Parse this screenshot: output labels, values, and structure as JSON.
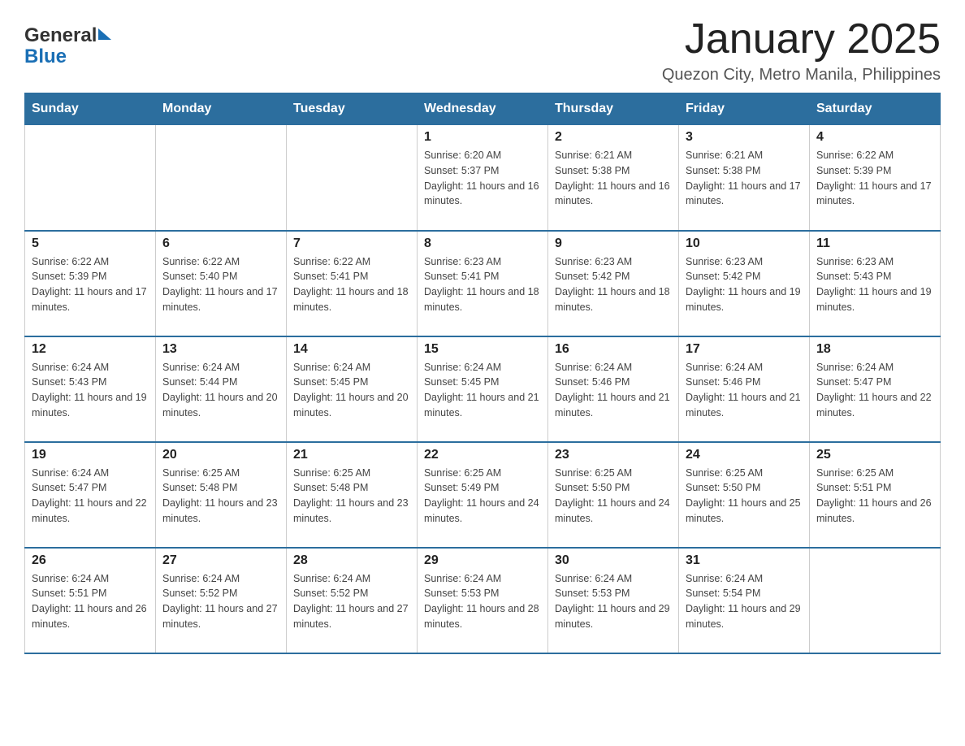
{
  "header": {
    "logo_general": "General",
    "logo_blue": "Blue",
    "main_title": "January 2025",
    "subtitle": "Quezon City, Metro Manila, Philippines"
  },
  "calendar": {
    "days_of_week": [
      "Sunday",
      "Monday",
      "Tuesday",
      "Wednesday",
      "Thursday",
      "Friday",
      "Saturday"
    ],
    "rows": [
      [
        {
          "day": "",
          "info": ""
        },
        {
          "day": "",
          "info": ""
        },
        {
          "day": "",
          "info": ""
        },
        {
          "day": "1",
          "info": "Sunrise: 6:20 AM\nSunset: 5:37 PM\nDaylight: 11 hours and 16 minutes."
        },
        {
          "day": "2",
          "info": "Sunrise: 6:21 AM\nSunset: 5:38 PM\nDaylight: 11 hours and 16 minutes."
        },
        {
          "day": "3",
          "info": "Sunrise: 6:21 AM\nSunset: 5:38 PM\nDaylight: 11 hours and 17 minutes."
        },
        {
          "day": "4",
          "info": "Sunrise: 6:22 AM\nSunset: 5:39 PM\nDaylight: 11 hours and 17 minutes."
        }
      ],
      [
        {
          "day": "5",
          "info": "Sunrise: 6:22 AM\nSunset: 5:39 PM\nDaylight: 11 hours and 17 minutes."
        },
        {
          "day": "6",
          "info": "Sunrise: 6:22 AM\nSunset: 5:40 PM\nDaylight: 11 hours and 17 minutes."
        },
        {
          "day": "7",
          "info": "Sunrise: 6:22 AM\nSunset: 5:41 PM\nDaylight: 11 hours and 18 minutes."
        },
        {
          "day": "8",
          "info": "Sunrise: 6:23 AM\nSunset: 5:41 PM\nDaylight: 11 hours and 18 minutes."
        },
        {
          "day": "9",
          "info": "Sunrise: 6:23 AM\nSunset: 5:42 PM\nDaylight: 11 hours and 18 minutes."
        },
        {
          "day": "10",
          "info": "Sunrise: 6:23 AM\nSunset: 5:42 PM\nDaylight: 11 hours and 19 minutes."
        },
        {
          "day": "11",
          "info": "Sunrise: 6:23 AM\nSunset: 5:43 PM\nDaylight: 11 hours and 19 minutes."
        }
      ],
      [
        {
          "day": "12",
          "info": "Sunrise: 6:24 AM\nSunset: 5:43 PM\nDaylight: 11 hours and 19 minutes."
        },
        {
          "day": "13",
          "info": "Sunrise: 6:24 AM\nSunset: 5:44 PM\nDaylight: 11 hours and 20 minutes."
        },
        {
          "day": "14",
          "info": "Sunrise: 6:24 AM\nSunset: 5:45 PM\nDaylight: 11 hours and 20 minutes."
        },
        {
          "day": "15",
          "info": "Sunrise: 6:24 AM\nSunset: 5:45 PM\nDaylight: 11 hours and 21 minutes."
        },
        {
          "day": "16",
          "info": "Sunrise: 6:24 AM\nSunset: 5:46 PM\nDaylight: 11 hours and 21 minutes."
        },
        {
          "day": "17",
          "info": "Sunrise: 6:24 AM\nSunset: 5:46 PM\nDaylight: 11 hours and 21 minutes."
        },
        {
          "day": "18",
          "info": "Sunrise: 6:24 AM\nSunset: 5:47 PM\nDaylight: 11 hours and 22 minutes."
        }
      ],
      [
        {
          "day": "19",
          "info": "Sunrise: 6:24 AM\nSunset: 5:47 PM\nDaylight: 11 hours and 22 minutes."
        },
        {
          "day": "20",
          "info": "Sunrise: 6:25 AM\nSunset: 5:48 PM\nDaylight: 11 hours and 23 minutes."
        },
        {
          "day": "21",
          "info": "Sunrise: 6:25 AM\nSunset: 5:48 PM\nDaylight: 11 hours and 23 minutes."
        },
        {
          "day": "22",
          "info": "Sunrise: 6:25 AM\nSunset: 5:49 PM\nDaylight: 11 hours and 24 minutes."
        },
        {
          "day": "23",
          "info": "Sunrise: 6:25 AM\nSunset: 5:50 PM\nDaylight: 11 hours and 24 minutes."
        },
        {
          "day": "24",
          "info": "Sunrise: 6:25 AM\nSunset: 5:50 PM\nDaylight: 11 hours and 25 minutes."
        },
        {
          "day": "25",
          "info": "Sunrise: 6:25 AM\nSunset: 5:51 PM\nDaylight: 11 hours and 26 minutes."
        }
      ],
      [
        {
          "day": "26",
          "info": "Sunrise: 6:24 AM\nSunset: 5:51 PM\nDaylight: 11 hours and 26 minutes."
        },
        {
          "day": "27",
          "info": "Sunrise: 6:24 AM\nSunset: 5:52 PM\nDaylight: 11 hours and 27 minutes."
        },
        {
          "day": "28",
          "info": "Sunrise: 6:24 AM\nSunset: 5:52 PM\nDaylight: 11 hours and 27 minutes."
        },
        {
          "day": "29",
          "info": "Sunrise: 6:24 AM\nSunset: 5:53 PM\nDaylight: 11 hours and 28 minutes."
        },
        {
          "day": "30",
          "info": "Sunrise: 6:24 AM\nSunset: 5:53 PM\nDaylight: 11 hours and 29 minutes."
        },
        {
          "day": "31",
          "info": "Sunrise: 6:24 AM\nSunset: 5:54 PM\nDaylight: 11 hours and 29 minutes."
        },
        {
          "day": "",
          "info": ""
        }
      ]
    ]
  }
}
